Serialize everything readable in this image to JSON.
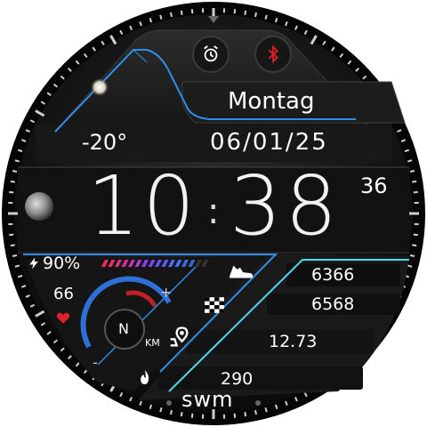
{
  "watch": {
    "day": "Montag",
    "temperature": "-20°",
    "date": "06/01/25",
    "time_hours": "10",
    "time_minutes": "38",
    "time_seconds": "36",
    "battery": "90%",
    "battery_level": 0.9,
    "heart_rate": "66",
    "steps": "6366",
    "goal": "6568",
    "distance": "12.73",
    "calories": "290",
    "compass": "N",
    "distance_unit": "KM",
    "brand": "swm",
    "plus": "+",
    "minus": "-"
  },
  "icons": {
    "alarm": "alarm-clock-icon",
    "bluetooth": "bluetooth-icon",
    "heart": "heart-icon",
    "battery": "lightning-icon",
    "steps": "shoe-icon",
    "goal": "checkered-flag-icon",
    "distance": "route-pin-icon",
    "calories": "flame-icon",
    "sun": "sun-icon",
    "moon": "moon-phase-icon"
  },
  "colors": {
    "accent_blue": "#2f8fe8",
    "accent_cyan": "#4fd8f0",
    "alert_red": "#e0202a"
  }
}
